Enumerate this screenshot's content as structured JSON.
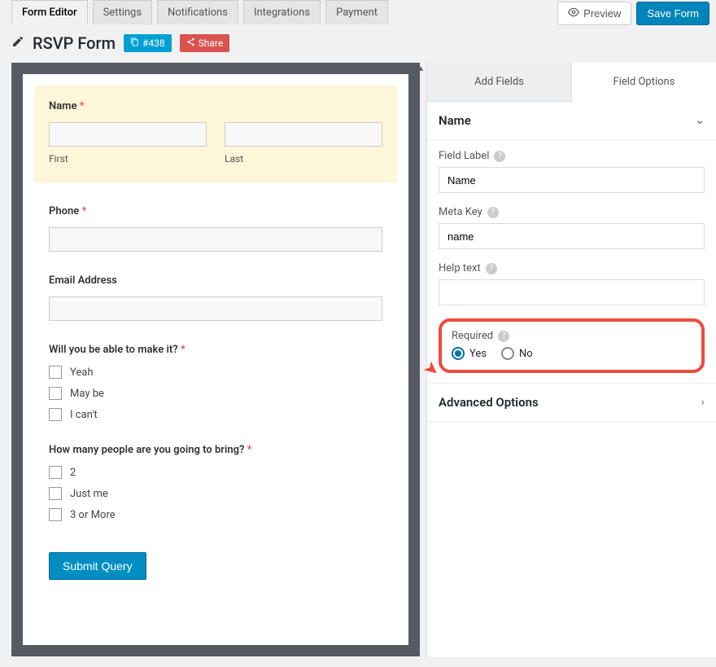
{
  "tabs": [
    "Form Editor",
    "Settings",
    "Notifications",
    "Integrations",
    "Payment"
  ],
  "actions": {
    "preview": "Preview",
    "save": "Save Form"
  },
  "subbar": {
    "formName": "RSVP Form",
    "idBadge": "#438",
    "share": "Share"
  },
  "form": {
    "name": {
      "label": "Name",
      "first": "First",
      "last": "Last"
    },
    "phone": {
      "label": "Phone"
    },
    "email": {
      "label": "Email Address"
    },
    "attend": {
      "label": "Will you be able to make it?",
      "options": [
        "Yeah",
        "May be",
        "I can't"
      ]
    },
    "people": {
      "label": "How many people are you going to bring?",
      "options": [
        "2",
        "Just me",
        "3 or More"
      ]
    },
    "submit": "Submit Query"
  },
  "panel": {
    "addFields": "Add Fields",
    "fieldOptions": "Field Options",
    "sectionTitle": "Name",
    "fieldLabel": {
      "label": "Field Label",
      "value": "Name"
    },
    "metaKey": {
      "label": "Meta Key",
      "value": "name"
    },
    "helpText": {
      "label": "Help text",
      "value": ""
    },
    "required": {
      "label": "Required",
      "yes": "Yes",
      "no": "No"
    },
    "advanced": "Advanced Options"
  }
}
